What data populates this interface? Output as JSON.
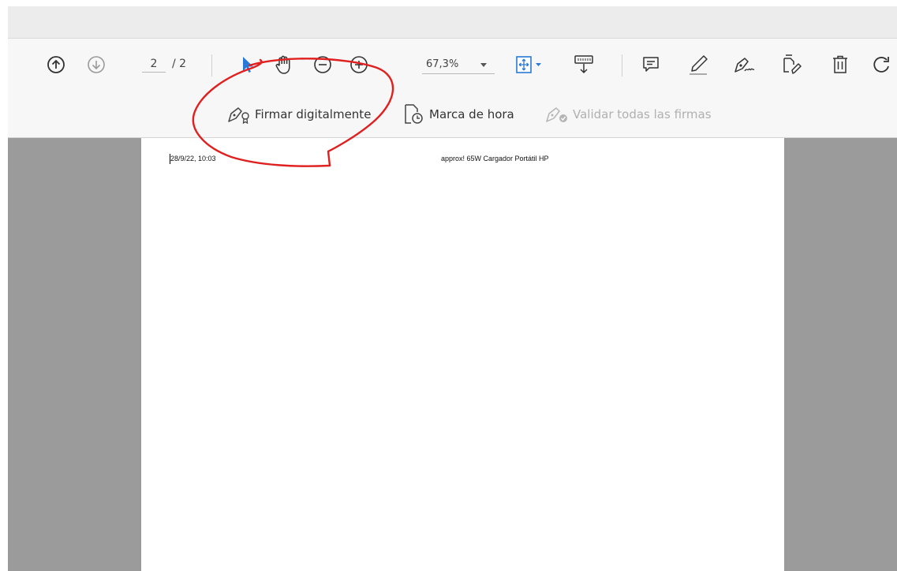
{
  "toolbar": {
    "page_current": "2",
    "page_total": "/ 2",
    "zoom_value": "67,3%",
    "icons": [
      "arrow-up-circle-icon",
      "arrow-down-circle-icon",
      "select-arrow-icon",
      "hand-icon",
      "zoom-out-icon",
      "zoom-in-icon",
      "fit-page-icon",
      "scroll-mode-icon",
      "comment-icon",
      "highlight-icon",
      "sign-icon",
      "fill-sign-icon",
      "delete-icon",
      "rotate-icon"
    ],
    "accent_color": "#2a7ad5"
  },
  "sign_bar": {
    "digital_sign_label": "Firmar digitalmente",
    "timestamp_label": "Marca de hora",
    "validate_label": "Validar todas las firmas"
  },
  "document": {
    "header_left": "28/9/22, 10:03",
    "header_center": "approx! 65W Cargador Portátil HP"
  },
  "annotation_color": "#e01f1f"
}
